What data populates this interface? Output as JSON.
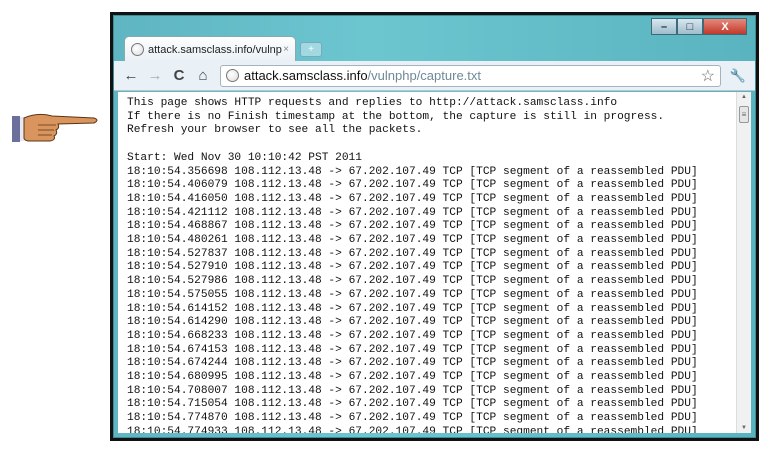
{
  "tab": {
    "title": "attack.samsclass.info/vulnp",
    "close": "×",
    "new_tab": "+"
  },
  "window": {
    "minimize": "–",
    "maximize": "□",
    "close": "X"
  },
  "toolbar": {
    "back": "←",
    "forward": "→",
    "reload": "C",
    "home": "⌂",
    "url_host": "attack.samsclass.info",
    "url_path": "/vulnphp/capture.txt",
    "star": "☆",
    "wrench": "🔧"
  },
  "content": {
    "header": [
      "This page shows HTTP requests and replies to http://attack.samsclass.info",
      "If there is no Finish timestamp at the bottom, the capture is still in progress.",
      "Refresh your browser to see all the packets.",
      "",
      "Start: Wed Nov 30 10:10:42 PST 2011"
    ],
    "packet_suffix": " 108.112.13.48 -> 67.202.107.49 TCP [TCP segment of a reassembled PDU]",
    "timestamps": [
      "18:10:54.356698",
      "18:10:54.406079",
      "18:10:54.416050",
      "18:10:54.421112",
      "18:10:54.468867",
      "18:10:54.480261",
      "18:10:54.527837",
      "18:10:54.527910",
      "18:10:54.527986",
      "18:10:54.575055",
      "18:10:54.614152",
      "18:10:54.614290",
      "18:10:54.668233",
      "18:10:54.674153",
      "18:10:54.674244",
      "18:10:54.680995",
      "18:10:54.708007",
      "18:10:54.715054",
      "18:10:54.774870",
      "18:10:54.774933"
    ]
  }
}
